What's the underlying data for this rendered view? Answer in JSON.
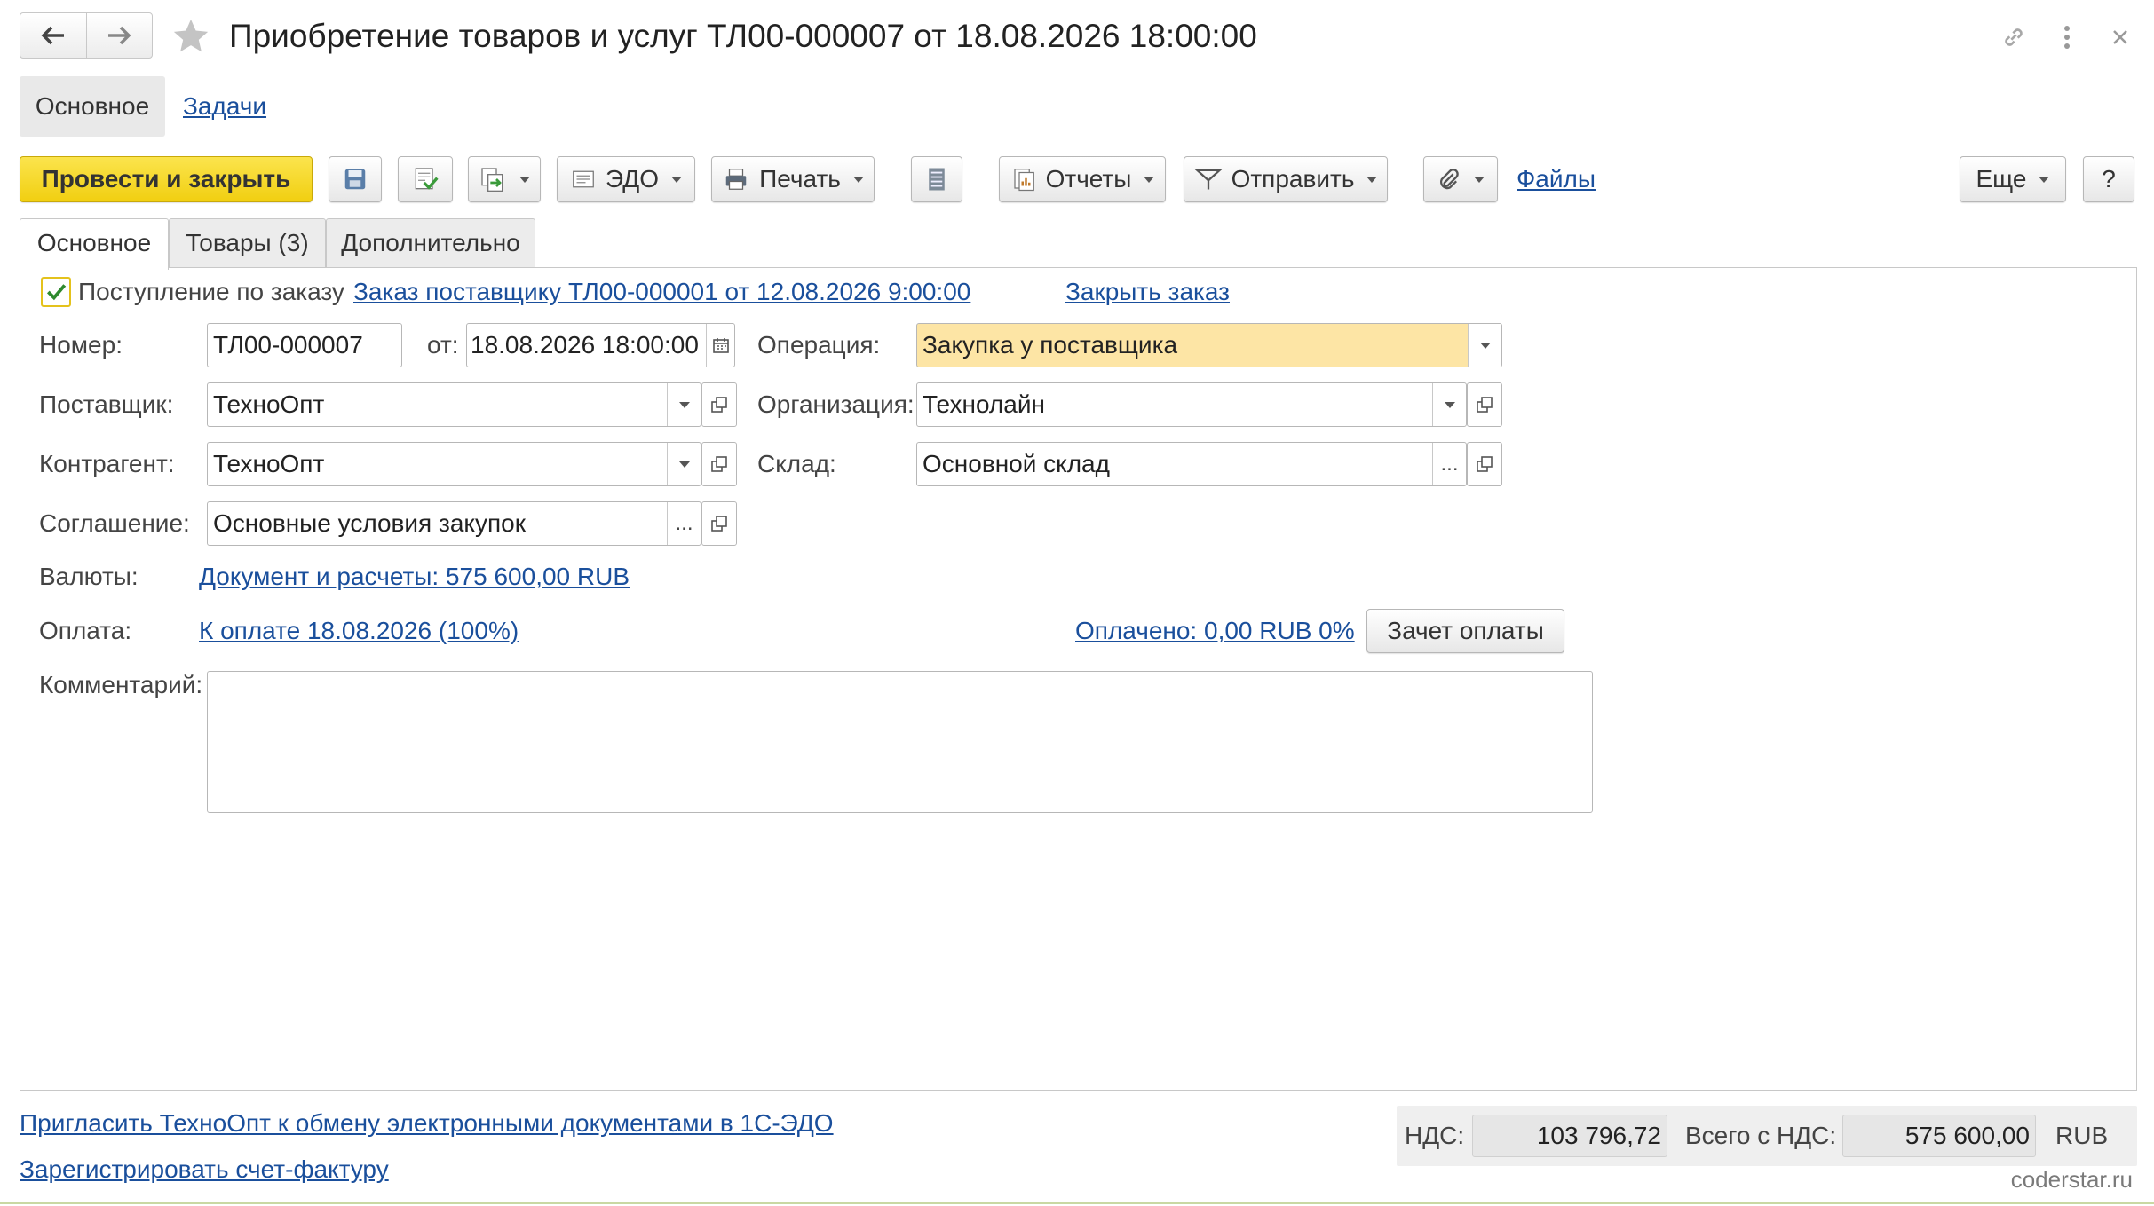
{
  "window": {
    "title": "Приобретение товаров и услуг ТЛ00-000007 от 18.08.2026 18:00:00",
    "icons": [
      "back-arrow-icon",
      "forward-arrow-icon",
      "star-icon",
      "link-icon",
      "more-vertical-icon",
      "close-icon"
    ]
  },
  "sections": {
    "main": "Основное",
    "tasks": "Задачи"
  },
  "toolbar": {
    "post_close": "Провести и закрыть",
    "edo": "ЭДО",
    "print": "Печать",
    "reports": "Отчеты",
    "send": "Отправить",
    "files": "Файлы",
    "more": "Еще",
    "help": "?"
  },
  "tabs": [
    "Основное",
    "Товары (3)",
    "Дополнительно"
  ],
  "form": {
    "by_order_label": "Поступление по заказу",
    "by_order_checked": true,
    "order_link": "Заказ поставщику ТЛ00-000001 от 12.08.2026 9:00:00",
    "close_order": "Закрыть заказ",
    "number_label": "Номер:",
    "number": "ТЛ00-000007",
    "date_label": "от:",
    "date": "18.08.2026 18:00:00",
    "operation_label": "Операция:",
    "operation": "Закупка у поставщика",
    "supplier_label": "Поставщик:",
    "supplier": "ТехноОпт",
    "org_label": "Организация:",
    "org": "Технолайн",
    "counterparty_label": "Контрагент:",
    "counterparty": "ТехноОпт",
    "warehouse_label": "Склад:",
    "warehouse": "Основной склад",
    "agreement_label": "Соглашение:",
    "agreement": "Основные условия закупок",
    "currency_label": "Валюты:",
    "currency_link": "Документ и расчеты: 575 600,00 RUB",
    "payment_label": "Оплата:",
    "payment_link": "К оплате 18.08.2026 (100%)",
    "paid_link": "Оплачено: 0,00 RUB 0%",
    "offset_button": "Зачет оплаты",
    "comment_label": "Комментарий:",
    "comment": ""
  },
  "footer": {
    "invite_link": "Пригласить ТехноОпт к обмену электронными документами в 1С-ЭДО",
    "invoice_link": "Зарегистрировать счет-фактуру",
    "vat_label": "НДС:",
    "vat": "103 796,72",
    "total_label": "Всего с НДС:",
    "total": "575 600,00",
    "currency": "RUB",
    "watermark": "coderstar.ru"
  }
}
